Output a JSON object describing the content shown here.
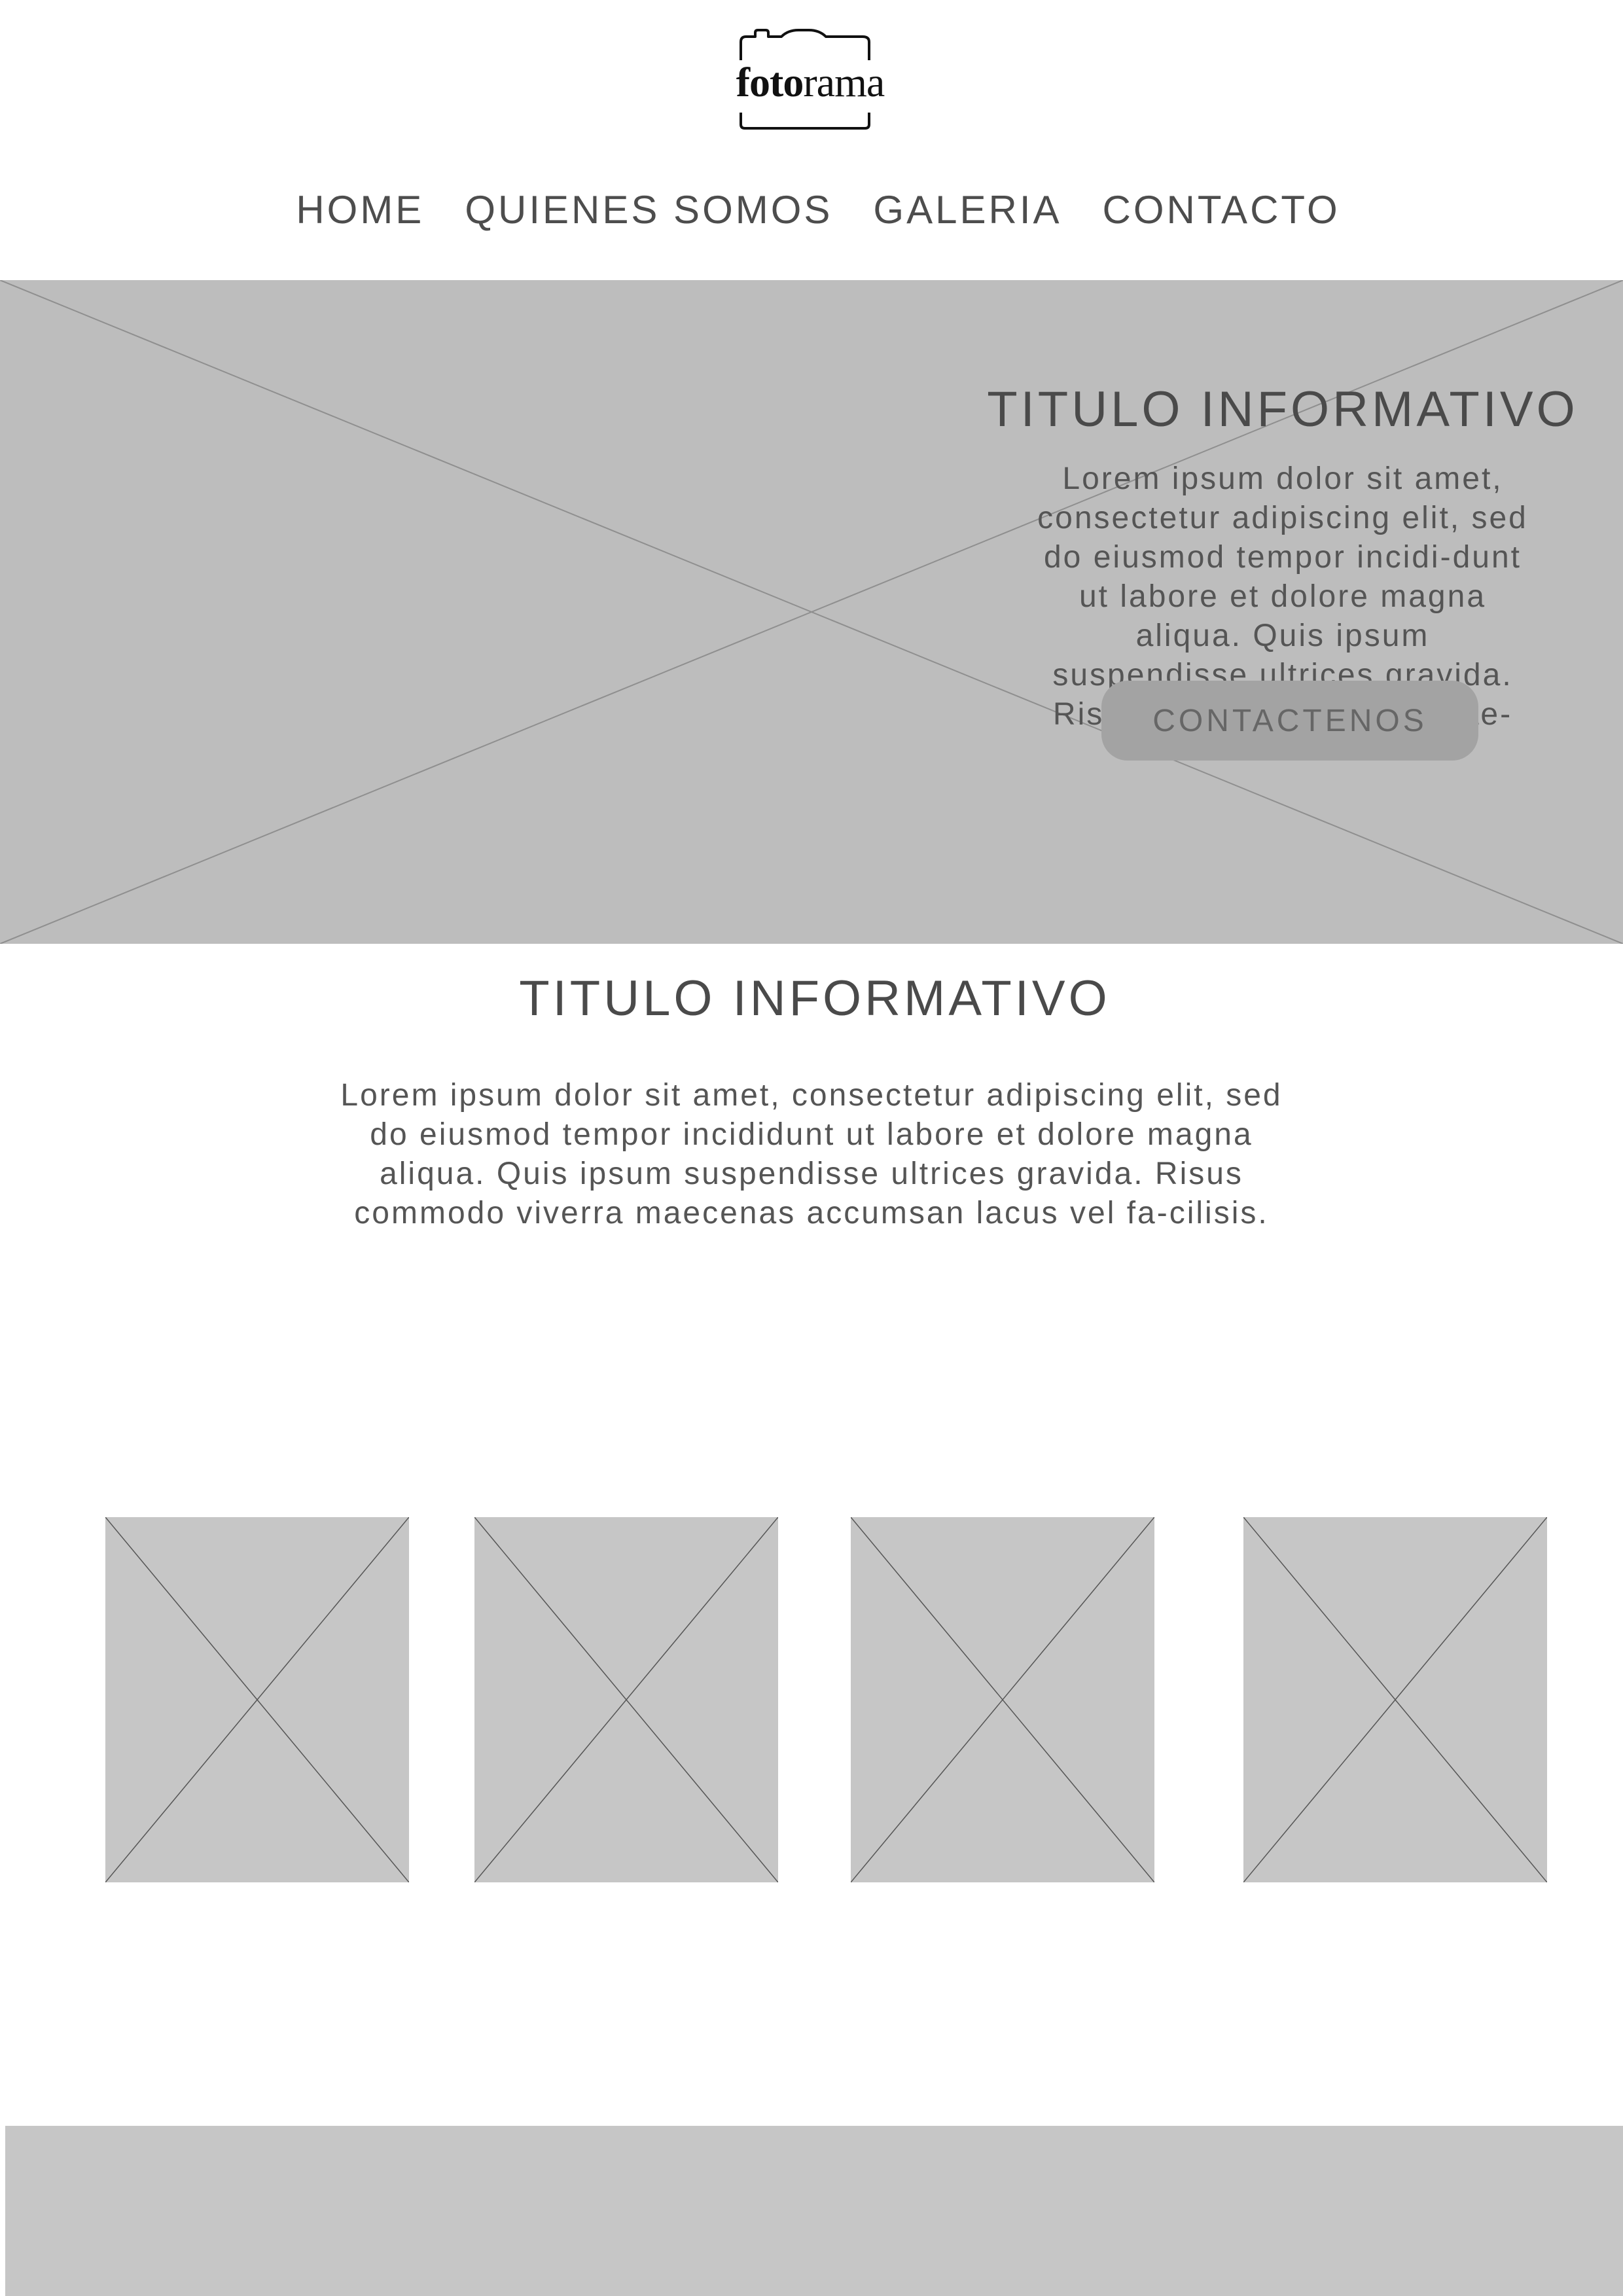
{
  "brand": {
    "name_bold": "foto",
    "name_regular": "rama"
  },
  "nav": {
    "items": [
      {
        "label": "HOME"
      },
      {
        "label": "QUIENES SOMOS"
      },
      {
        "label": "GALERIA"
      },
      {
        "label": "CONTACTO"
      }
    ]
  },
  "hero": {
    "title": "TITULO INFORMATIVO",
    "text": "Lorem ipsum dolor sit amet, consectetur adipiscing elit, sed do eiusmod tempor incidi-dunt ut labore et dolore magna aliqua. Quis ipsum suspendisse ultrices gravida. Risus commodo viverra mae-",
    "button_label": "CONTACTENOS"
  },
  "section": {
    "title": "TITULO INFORMATIVO",
    "text": "Lorem ipsum dolor sit amet, consectetur adipiscing elit, sed do eiusmod tempor incididunt ut labore et dolore magna aliqua. Quis ipsum suspendisse ultrices gravida. Risus commodo viverra maecenas accumsan lacus vel fa-cilisis."
  },
  "gallery": {
    "count": 4
  },
  "colors": {
    "placeholder_hero": "#bdbdbd",
    "placeholder_gallery": "#c6c6c6",
    "button": "#a3a3a3",
    "text": "#4d4d4d"
  }
}
